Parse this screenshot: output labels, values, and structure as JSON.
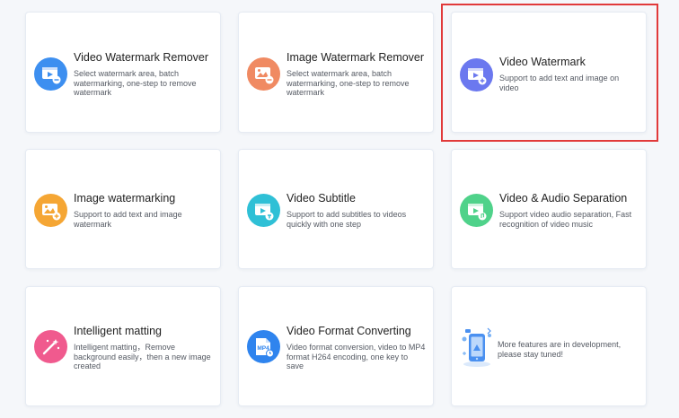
{
  "cards": [
    {
      "title": "Video Watermark Remover",
      "desc": "Select watermark area, batch watermarking, one-step to remove watermark",
      "icon": "video-watermark-remover-icon",
      "color": "#3d8ff0"
    },
    {
      "title": "Image Watermark Remover",
      "desc": "Select watermark area, batch watermarking, one-step to remove watermark",
      "icon": "image-watermark-remover-icon",
      "color": "#f08a62"
    },
    {
      "title": "Video Watermark",
      "desc": "Support to add text and image on video",
      "icon": "video-watermark-icon",
      "color": "#6b78ef"
    },
    {
      "title": "Image watermarking",
      "desc": "Support to add text and image watermark",
      "icon": "image-watermarking-icon",
      "color": "#f5a634"
    },
    {
      "title": "Video Subtitle",
      "desc": "Support to add subtitles to videos quickly with one step",
      "icon": "video-subtitle-icon",
      "color": "#2fc0d6"
    },
    {
      "title": "Video & Audio Separation",
      "desc": "Support video audio separation, Fast recognition of video music",
      "icon": "video-audio-separation-icon",
      "color": "#4fd28a"
    },
    {
      "title": "Intelligent matting",
      "desc": "Intelligent matting，Remove background easily，then a new image created",
      "icon": "intelligent-matting-icon",
      "color": "#f05a8e"
    },
    {
      "title": "Video Format Converting",
      "desc": "Video format conversion, video to MP4 format H264 encoding, one key to save",
      "icon": "video-format-converting-icon",
      "color": "#2f84ee",
      "badge": "MP4"
    }
  ],
  "more": {
    "text": "More features are in development, please stay tuned!",
    "icon": "in-development-illustration-icon"
  },
  "selected_card": "Video Watermark",
  "colors": {
    "selection_border": "#e13a3a",
    "card_border": "#e6ebf3"
  }
}
